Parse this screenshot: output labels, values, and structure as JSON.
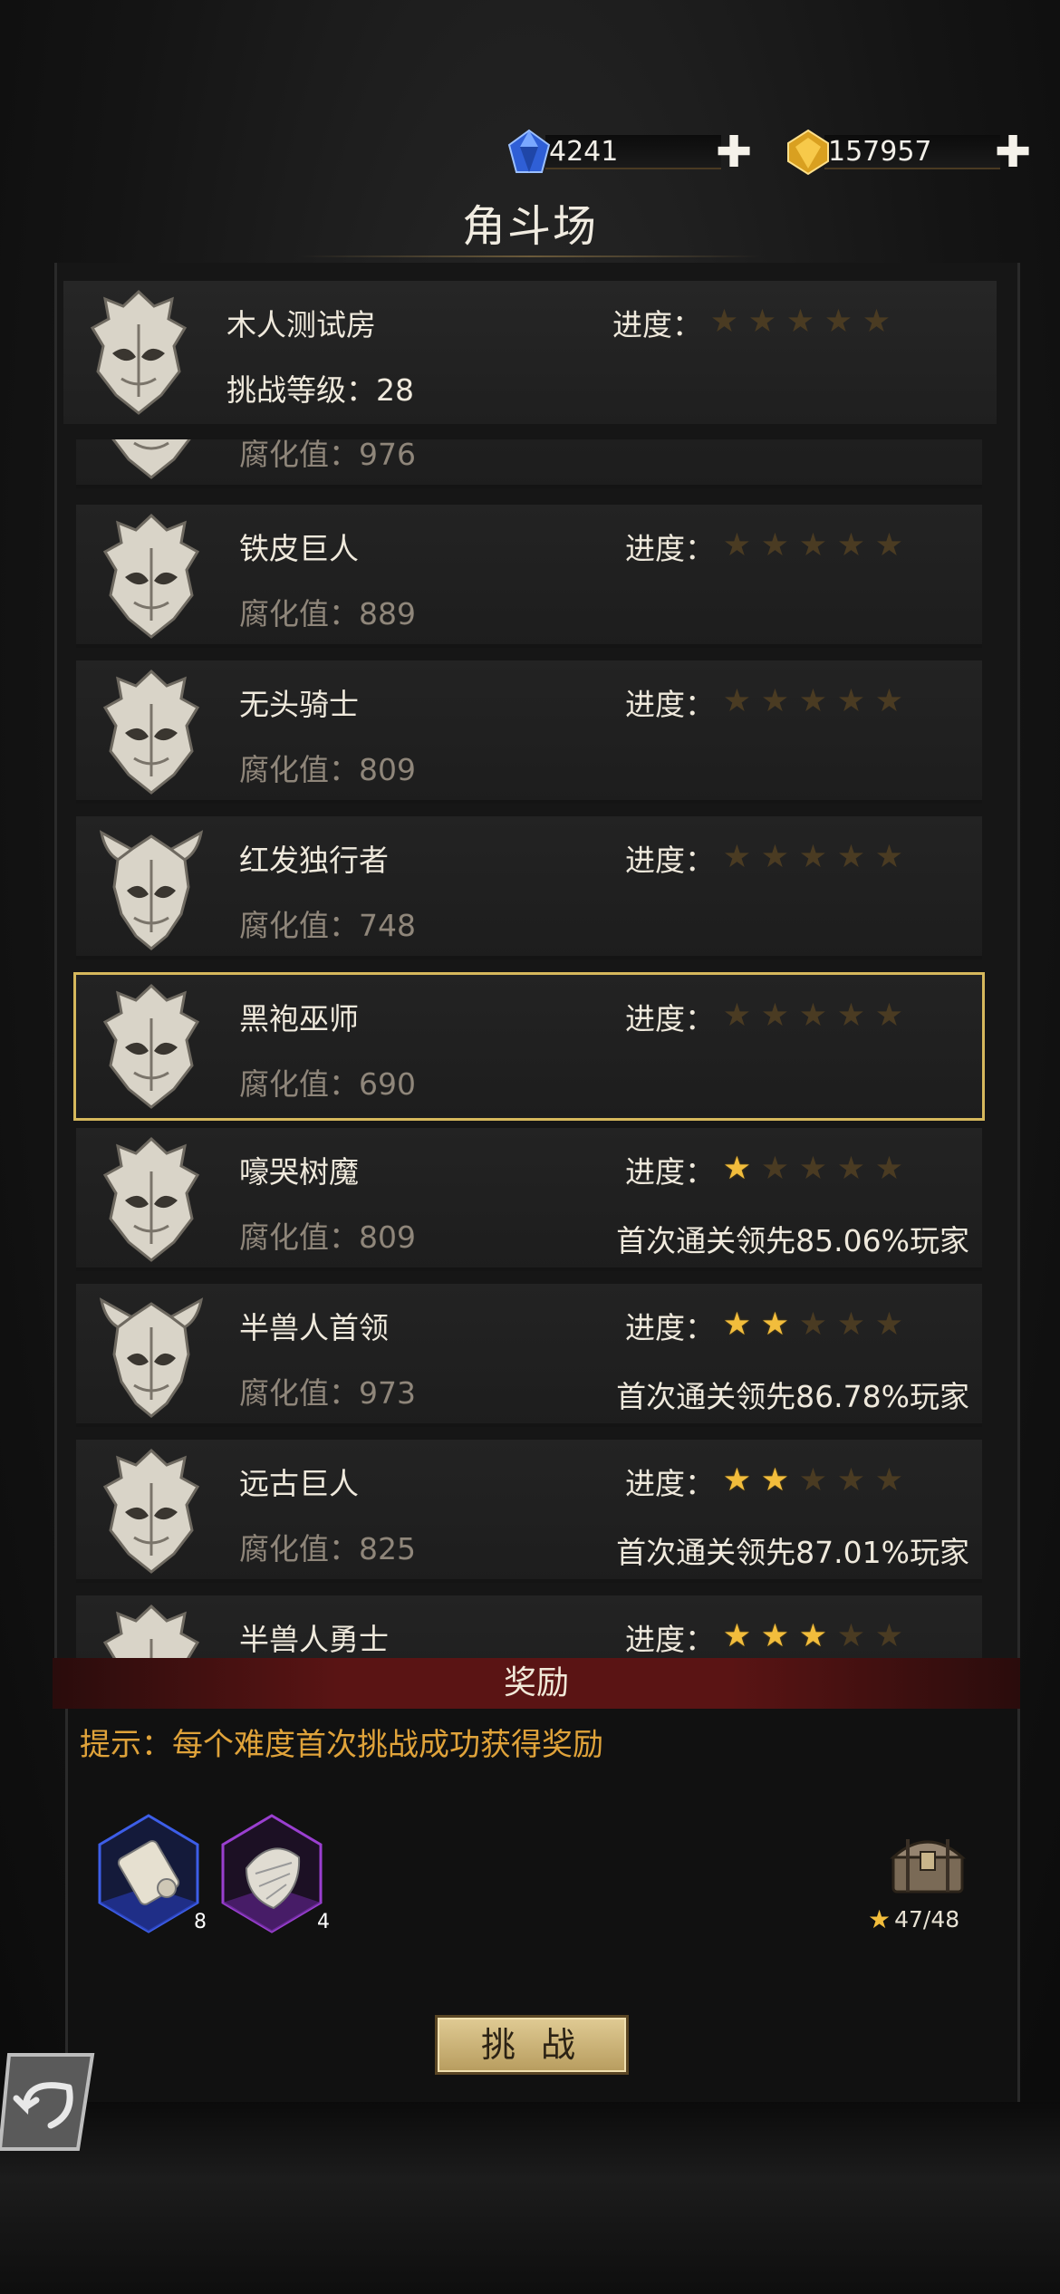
{
  "currencies": {
    "diamond": {
      "value": "4241",
      "icon": "blue-gem-icon"
    },
    "gold": {
      "value": "157957",
      "icon": "gold-gem-icon"
    }
  },
  "title": "角斗场",
  "top_card": {
    "name": "木人测试房",
    "sub": "挑战等级：28",
    "progress_label": "进度：",
    "stars": 0
  },
  "partial_card": {
    "sub": "腐化值：976"
  },
  "opponents": [
    {
      "name": "铁皮巨人",
      "sub": "腐化值：889",
      "stars": 0,
      "first": "",
      "horns": false,
      "selected": false
    },
    {
      "name": "无头骑士",
      "sub": "腐化值：809",
      "stars": 0,
      "first": "",
      "horns": false,
      "selected": false
    },
    {
      "name": "红发独行者",
      "sub": "腐化值：748",
      "stars": 0,
      "first": "",
      "horns": true,
      "selected": false
    },
    {
      "name": "黑袍巫师",
      "sub": "腐化值：690",
      "stars": 0,
      "first": "",
      "horns": false,
      "selected": true
    },
    {
      "name": "嚎哭树魔",
      "sub": "腐化值：809",
      "stars": 1,
      "first": "首次通关领先85.06%玩家",
      "horns": false,
      "selected": false
    },
    {
      "name": "半兽人首领",
      "sub": "腐化值：973",
      "stars": 2,
      "first": "首次通关领先86.78%玩家",
      "horns": true,
      "selected": false
    },
    {
      "name": "远古巨人",
      "sub": "腐化值：825",
      "stars": 2,
      "first": "首次通关领先87.01%玩家",
      "horns": false,
      "selected": false
    },
    {
      "name": "半兽人勇士",
      "sub": "",
      "stars": 3,
      "first": "",
      "horns": false,
      "selected": false
    }
  ],
  "progress_label": "进度：",
  "reward": {
    "header": "奖励",
    "hint": "提示：每个难度首次挑战成功获得奖励",
    "items": [
      {
        "icon": "scroll-icon",
        "count": "8",
        "rarity": "blue"
      },
      {
        "icon": "crystal-shard-icon",
        "count": "4",
        "rarity": "purple"
      }
    ],
    "chest_icon": "treasure-chest-icon",
    "chest_progress": "47/48"
  },
  "challenge_button": "挑 战",
  "back_icon": "back-arrow-icon"
}
